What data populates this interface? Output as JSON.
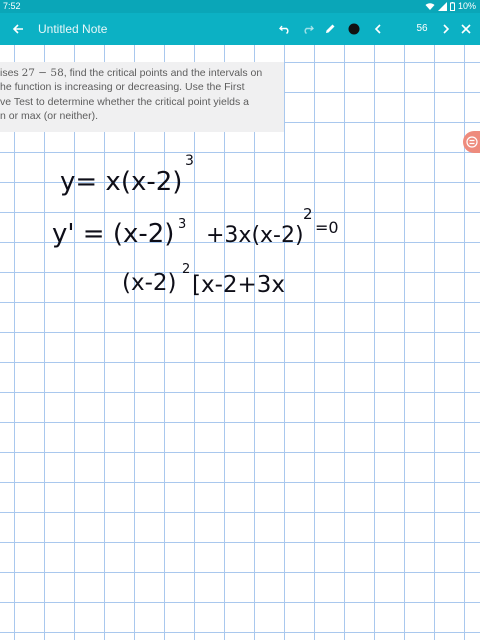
{
  "status_bar": {
    "time": "7:52",
    "battery": "10%"
  },
  "toolbar": {
    "title": "Untitled Note",
    "page_number": "56",
    "icons": [
      "back-arrow-icon",
      "undo-icon",
      "redo-icon",
      "pen-icon",
      "color-swatch-icon",
      "chevron-left-icon",
      "chevron-right-icon",
      "close-icon"
    ],
    "accent_color": "#0cb1c4"
  },
  "question": {
    "lines": [
      {
        "prefix": "ises ",
        "math": "27 − 58",
        "suffix": ", find the critical points and the intervals on"
      },
      {
        "text": "he function is increasing or decreasing. Use the First"
      },
      {
        "text": "ve Test to determine whether the critical point yields a"
      },
      {
        "text": "n or max (or neither)."
      }
    ]
  },
  "handwriting": {
    "line1": "y= x(x-2)",
    "line1_exp": "3",
    "line2_a": "y' = (x-2)",
    "line2_exp_a": "3",
    "line2_b": "+3x(x-2)",
    "line2_exp_b": "2",
    "line2_c": "=0",
    "line3_a": "(x-2)",
    "line3_exp": "2",
    "line3_b": "[x-2+3x"
  },
  "grid_color": "#a9c8ee"
}
